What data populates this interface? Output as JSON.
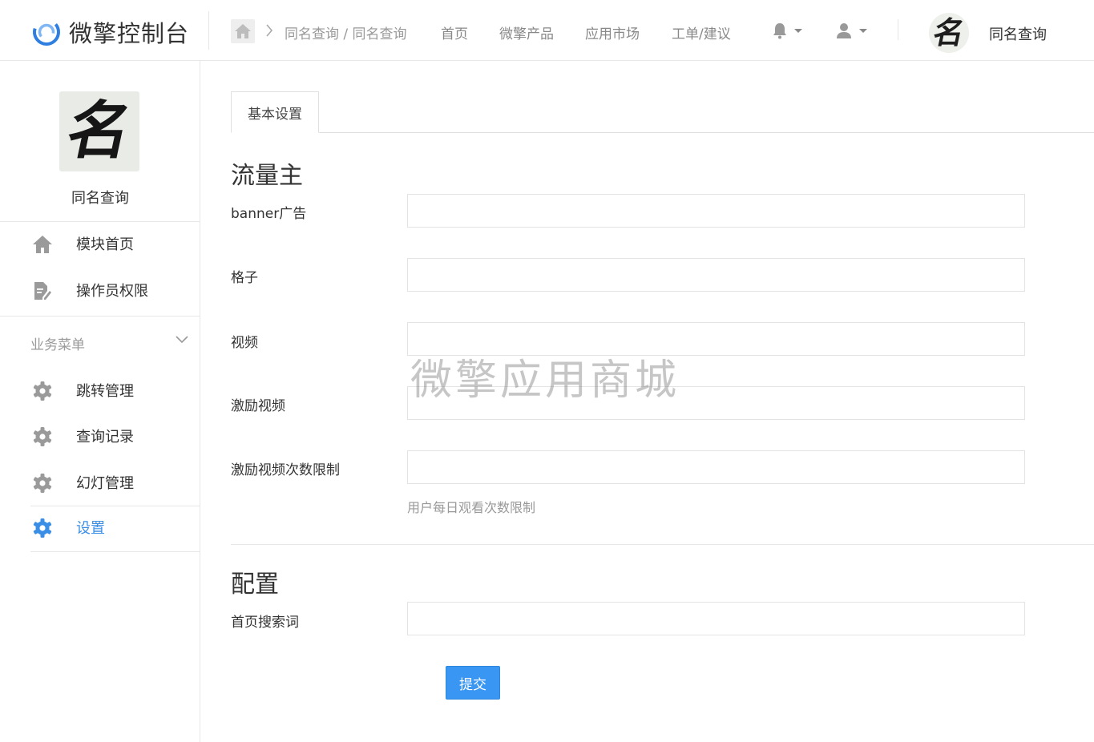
{
  "brand": {
    "name": "微擎控制台",
    "logo_icon": "swirl-logo-icon",
    "accent": "#3a96f3"
  },
  "breadcrumb": {
    "text": "同名查询 / 同名查询",
    "home_icon": "home-icon"
  },
  "nav": {
    "links": [
      "首页",
      "微擎产品",
      "应用市场",
      "工单/建议"
    ],
    "notifications_icon": "bell-icon",
    "user_icon": "user-icon"
  },
  "current_app": {
    "name": "同名查询",
    "avatar_glyph": "名"
  },
  "sidebar": {
    "app_name": "同名查询",
    "top_items": [
      {
        "label": "模块首页",
        "icon": "home-icon"
      },
      {
        "label": "操作员权限",
        "icon": "document-edit-icon"
      }
    ],
    "group_title": "业务菜单",
    "group_items": [
      {
        "label": "跳转管理",
        "icon": "gear-icon"
      },
      {
        "label": "查询记录",
        "icon": "gear-icon"
      },
      {
        "label": "幻灯管理",
        "icon": "gear-icon"
      },
      {
        "label": "设置",
        "icon": "gear-icon",
        "active": true
      }
    ]
  },
  "tabs": [
    {
      "label": "基本设置",
      "active": true
    }
  ],
  "sections": {
    "traffic_title": "流量主",
    "fields": [
      {
        "label": "banner广告",
        "value": ""
      },
      {
        "label": "格子",
        "value": ""
      },
      {
        "label": "视频",
        "value": ""
      },
      {
        "label": "激励视频",
        "value": ""
      },
      {
        "label": "激励视频次数限制",
        "value": "",
        "help": "用户每日观看次数限制"
      }
    ],
    "config_title": "配置",
    "config_fields": [
      {
        "label": "首页搜索词",
        "value": ""
      }
    ]
  },
  "submit_label": "提交",
  "watermark": "微擎应用商城"
}
